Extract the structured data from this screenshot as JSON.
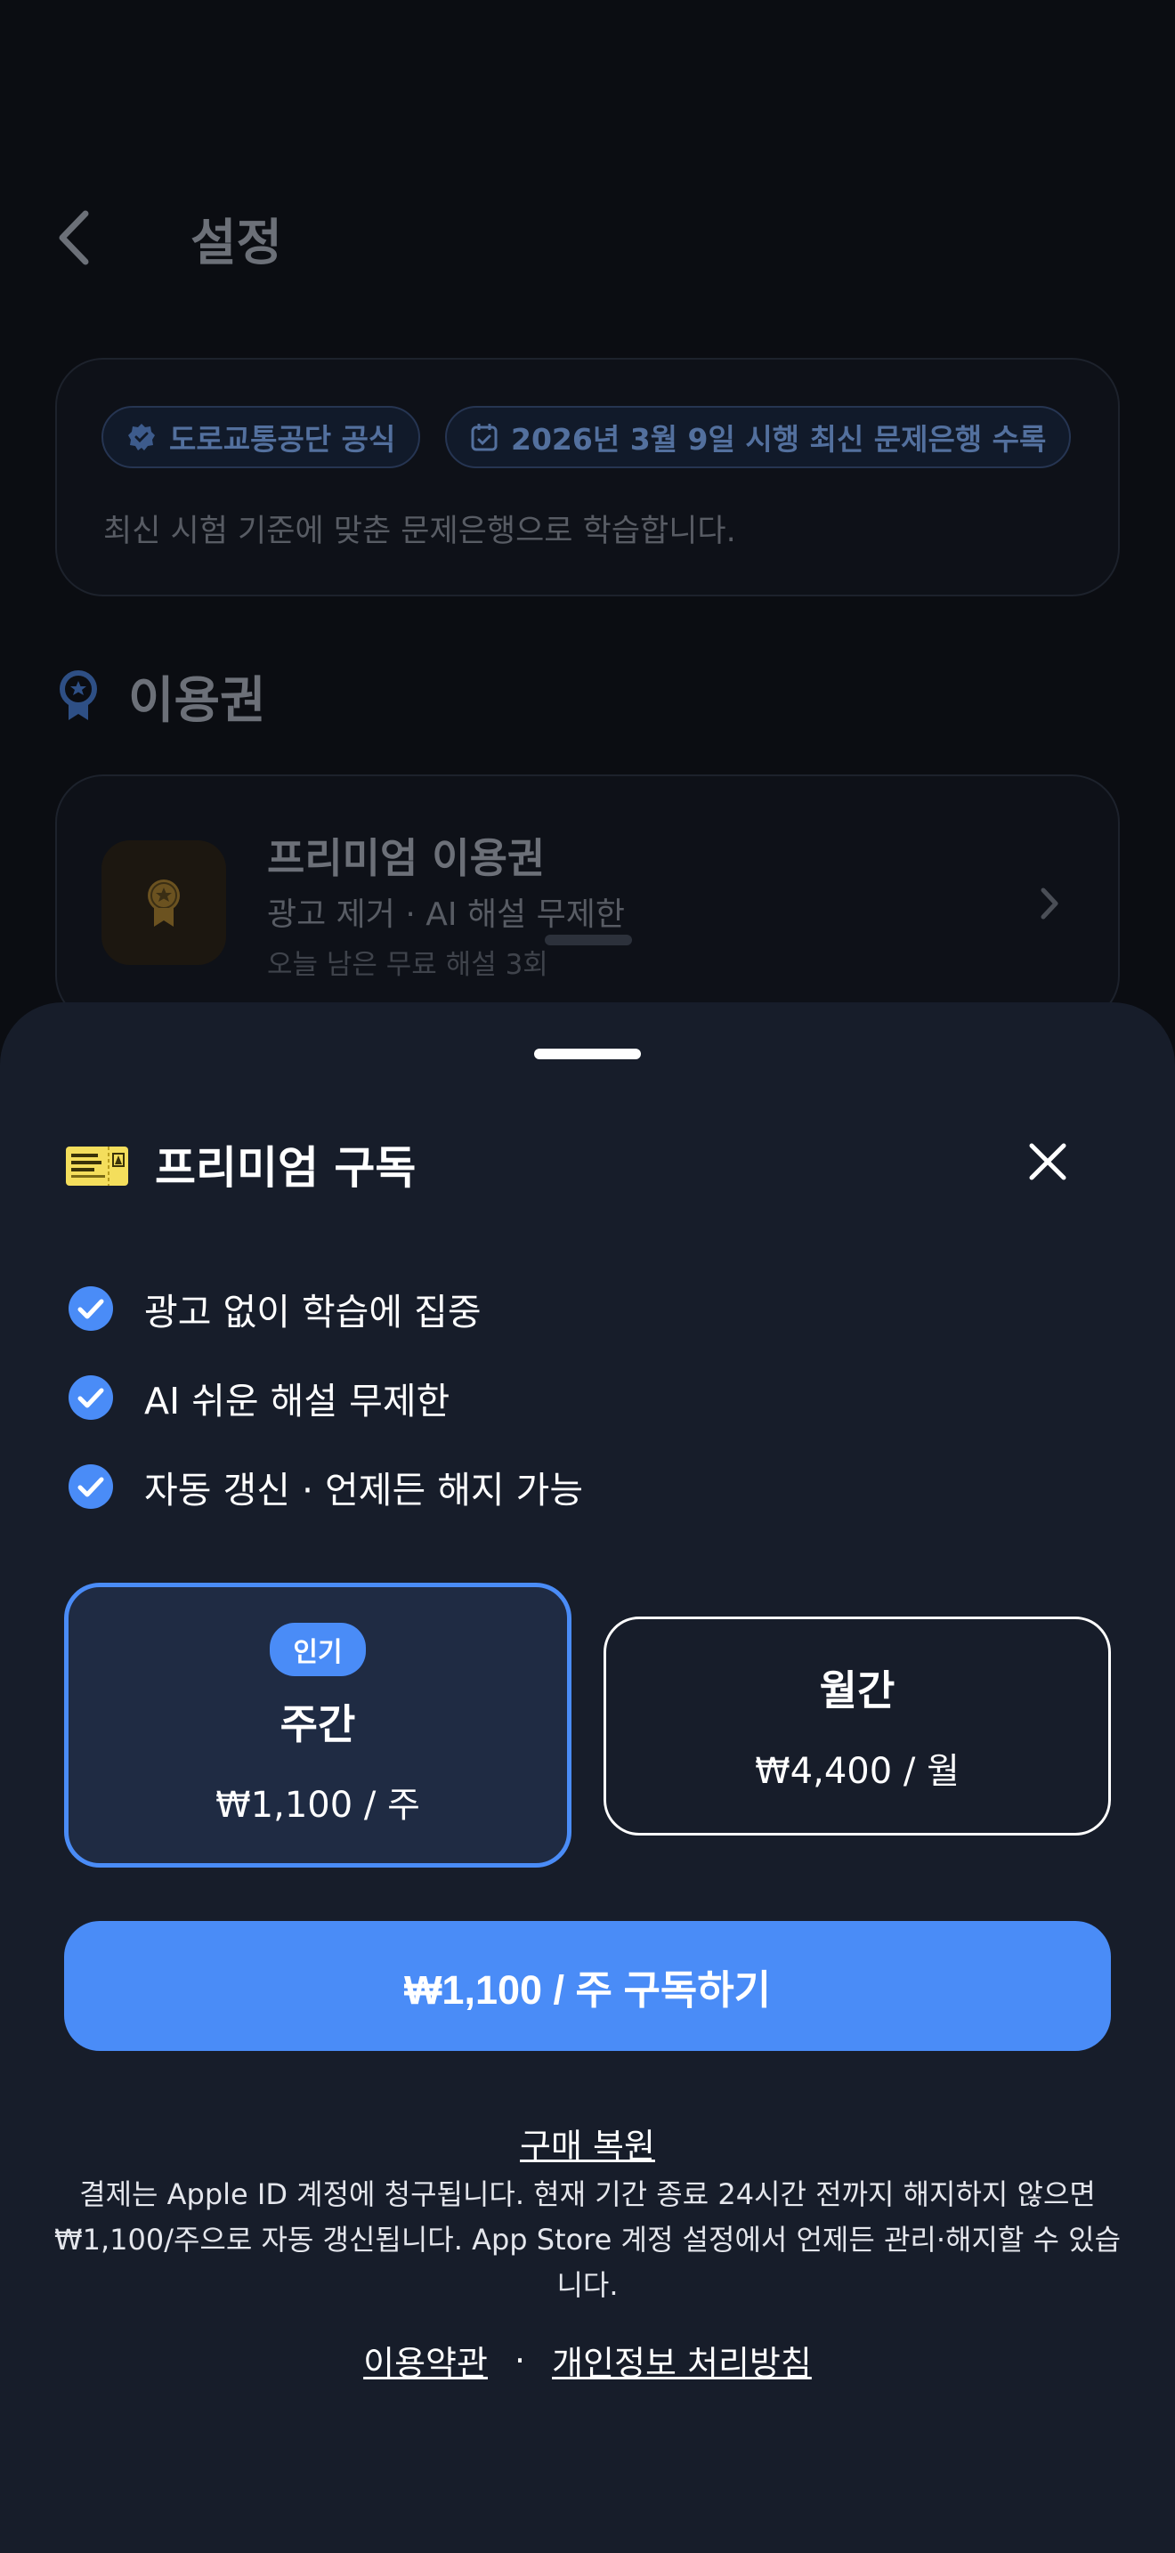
{
  "settings_page": {
    "title": "설정",
    "notice": {
      "chip_official": "도로교통공단 공식",
      "chip_date": "2026년 3월 9일 시행 최신 문제은행 수록",
      "description": "최신 시험 기준에 맞춘 문제은행으로 학습합니다."
    },
    "section_title": "이용권",
    "premium_card": {
      "title": "프리미엄 이용권",
      "subtitle": "광고 제거 · AI 해설 무제한",
      "remaining": "오늘 남은 무료 해설 3회"
    }
  },
  "sheet": {
    "title": "프리미엄 구독",
    "features": [
      "광고 없이 학습에 집중",
      "AI 쉬운 해설 무제한",
      "자동 갱신 · 언제든 해지 가능"
    ],
    "plans": [
      {
        "badge": "인기",
        "name": "주간",
        "price": "₩1,100 / 주",
        "selected": true
      },
      {
        "name": "월간",
        "price": "₩4,400 / 월",
        "selected": false
      }
    ],
    "cta_label": "₩1,100 / 주 구독하기",
    "restore_label": "구매 복원",
    "legal_text": "결제는 Apple ID 계정에 청구됩니다. 현재 기간 종료 24시간 전까지 해지하지 않으면 ₩1,100/주으로 자동 갱신됩니다. App Store 계정 설정에서 언제든 관리·해지할 수 있습니다.",
    "terms_label": "이용약관",
    "separator": "·",
    "privacy_label": "개인정보 처리방침"
  },
  "colors": {
    "accent": "#4a8cf7",
    "sheet_bg": "#171d2a",
    "page_bg": "#0b0d12"
  }
}
